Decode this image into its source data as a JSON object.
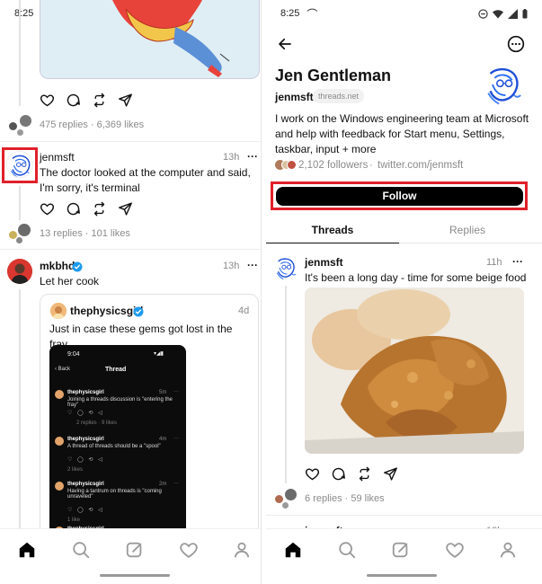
{
  "left": {
    "status": {
      "time": "8:25",
      "tilde": "⌒"
    },
    "post0": {
      "stats": "475 replies · 6,369 likes"
    },
    "post1": {
      "username": "jenmsft",
      "time": "13h",
      "more": "···",
      "text": "The doctor looked at the computer and said, I'm sorry, it's terminal",
      "stats": "13 replies · 101 likes"
    },
    "post2": {
      "username": "mkbhd",
      "time": "13h",
      "more": "···",
      "text": "Let her cook",
      "quote": {
        "username": "thephysicsgirl",
        "time": "4d",
        "text": "Just in case these gems got lost in the fray",
        "screenshot": {
          "time": "9:04",
          "back": "Back",
          "title": "Thread",
          "items": [
            {
              "user": "thephysicsgirl",
              "text": "Joining a threads discussion is \"entering the fray\"",
              "meta": "2 replies · 9 likes",
              "time": "5m"
            },
            {
              "user": "thephysicsgirl",
              "text": "A thread of threads should be a \"spool\"",
              "meta": "2 likes",
              "time": "4m"
            },
            {
              "user": "thephysicsgirl",
              "text": "Having a tantrum on threads is \"coming unraveled\"",
              "meta": "1 like",
              "time": "2m"
            },
            {
              "user": "thephysicsgirl",
              "text": "",
              "meta": "",
              "time": ""
            }
          ]
        }
      }
    }
  },
  "right": {
    "status": {
      "time": "8:25",
      "tilde": "⌒"
    },
    "profile": {
      "name": "Jen Gentleman",
      "handle": "jenmsft",
      "domain_badge": "threads.net",
      "bio": "I work on the Windows engineering team at Microsoft and help with feedback for Start menu, Settings, taskbar, input + more",
      "followers": "2,102 followers",
      "link": "twitter.com/jenmsft",
      "separator": "·"
    },
    "follow_label": "Follow",
    "tabs": [
      {
        "label": "Threads"
      },
      {
        "label": "Replies"
      }
    ],
    "post": {
      "username": "jenmsft",
      "time": "11h",
      "more": "···",
      "text": "It's been a long day - time for some beige food",
      "stats": "6 replies · 59 likes"
    },
    "next_post": {
      "username": "jenmsft",
      "time": "12h"
    }
  },
  "colors": {
    "highlight": "#e0202a",
    "verified": "#1d9bf0",
    "follow_bg": "#000000"
  },
  "icons": [
    "heart-icon",
    "comment-icon",
    "repost-icon",
    "share-icon",
    "home-icon",
    "search-icon",
    "compose-icon",
    "activity-heart-icon",
    "profile-icon",
    "back-arrow-icon",
    "more-circle-icon",
    "verified-icon"
  ]
}
